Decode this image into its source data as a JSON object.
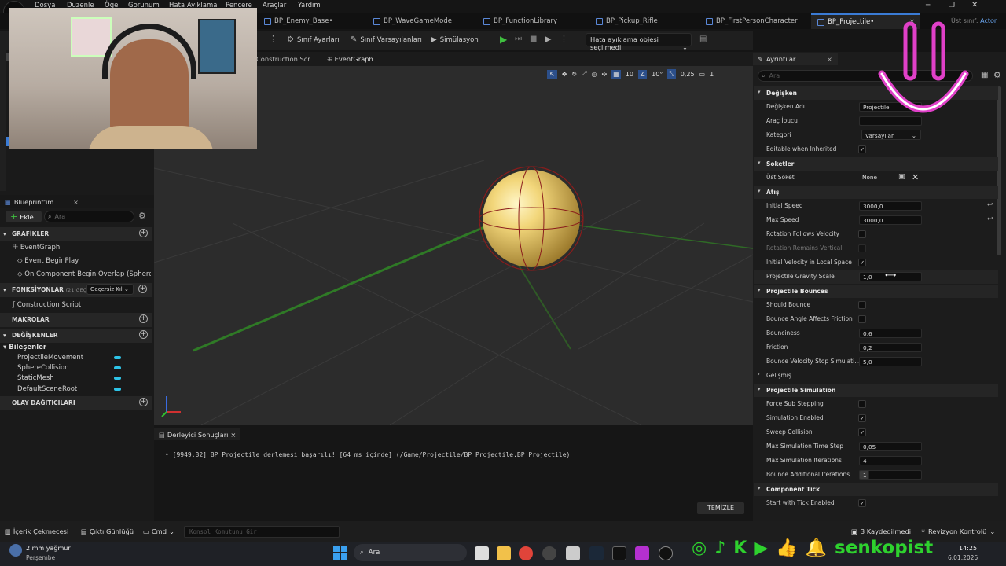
{
  "menu": [
    "Dosya",
    "Düzenle",
    "Öğe",
    "Görünüm",
    "Hata Ayıklama",
    "Pencere",
    "Araçlar",
    "Yardım"
  ],
  "tabs": [
    "BP_Enemy_Base•",
    "BP_WaveGameMode",
    "BP_FunctionLibrary",
    "BP_Pickup_Rifle",
    "BP_FirstPersonCharacter",
    "BP_Projectile•"
  ],
  "parent_class_label": "Üst sınıf:",
  "parent_class_value": "Actor",
  "toolbar": {
    "class_settings": "Sınıf Ayarları",
    "class_defaults": "Sınıf Varsayılanları",
    "simulation": "Simülasyon",
    "debug_object": "Hata ayıklama objesi seçilmedi"
  },
  "graph_tabs": [
    "Construction Scr...",
    "EventGraph"
  ],
  "viewport_controls": {
    "grid": "10",
    "rotation": "10°",
    "scale": "0,25",
    "camera": "1"
  },
  "my_blueprint": {
    "title": "Blueprint'im",
    "add": "Ekle",
    "search_placeholder": "Ara",
    "graphs_header": "GRAFİKLER",
    "event_graph": "EventGraph",
    "events": [
      "Event BeginPlay",
      "On Component Begin Overlap (SphereCol"
    ],
    "functions_header": "FONKSİYONLAR",
    "functions_count": "(21 GEÇERSİZ",
    "functions_filter": "Geçersiz Kıl",
    "construction_script": "Construction Script",
    "macros_header": "MAKROLAR",
    "variables_header": "DEĞİŞKENLER",
    "components_header": "Bileşenler",
    "components": [
      "ProjectileMovement",
      "SphereCollision",
      "StaticMesh",
      "DefaultSceneRoot"
    ],
    "dispatchers_header": "OLAY DAĞITICILARI"
  },
  "compiler": {
    "tab": "Derleyici Sonuçları",
    "message": "[9949.82] BP_Projectile derlemesi başarılı! [64 ms içinde] (/Game/Projectile/BP_Projectile.BP_Projectile)",
    "clear": "TEMİZLE"
  },
  "details": {
    "tab": "Ayrıntılar",
    "search_placeholder": "Ara",
    "variable_section": "Değişken",
    "var_name_label": "Değişken Adı",
    "var_name_value": "Projectile",
    "tooltip_label": "Araç İpucu",
    "category_label": "Kategori",
    "category_value": "Varsayılan",
    "editable_inherited": "Editable when Inherited",
    "sockets_section": "Soketler",
    "parent_socket_label": "Üst Soket",
    "parent_socket_value": "None",
    "firing_section": "Atış",
    "initial_speed_label": "Initial Speed",
    "initial_speed": "3000,0",
    "max_speed_label": "Max Speed",
    "max_speed": "3000,0",
    "rotation_follows_velocity": "Rotation Follows Velocity",
    "rotation_remains_vertical": "Rotation Remains Vertical",
    "initial_velocity_local": "Initial Velocity in Local Space",
    "gravity_scale_label": "Projectile Gravity Scale",
    "gravity_scale": "1,0",
    "bounces_section": "Projectile Bounces",
    "should_bounce": "Should Bounce",
    "bounce_angle_friction": "Bounce Angle Affects Friction",
    "bounciness_label": "Bounciness",
    "bounciness": "0,6",
    "friction_label": "Friction",
    "friction": "0,2",
    "bounce_velocity_stop_label": "Bounce Velocity Stop Simulati...",
    "bounce_velocity_stop": "5,0",
    "advanced": "Gelişmiş",
    "simulation_section": "Projectile Simulation",
    "force_sub_stepping": "Force Sub Stepping",
    "simulation_enabled": "Simulation Enabled",
    "sweep_collision": "Sweep Collision",
    "max_sim_time_step_label": "Max Simulation Time Step",
    "max_sim_time_step": "0,05",
    "max_sim_iterations_label": "Max Simulation Iterations",
    "max_sim_iterations": "4",
    "bounce_additional_iterations_label": "Bounce Additional Iterations",
    "bounce_additional_iterations": "1",
    "tick_section": "Component Tick",
    "start_with_tick": "Start with Tick Enabled"
  },
  "statusbar": {
    "content_drawer": "İçerik Çekmecesi",
    "output_log": "Çıktı Günlüğü",
    "cmd": "Cmd",
    "console_placeholder": "Konsol Komutunu Gir",
    "unsaved": "3 Kaydedilmedi",
    "revision": "Revizyon Kontrolü"
  },
  "taskbar": {
    "weather": "2 mm yağmur",
    "day": "Perşembe",
    "search": "Ara",
    "time": "14:25",
    "date": "6.01.2026"
  },
  "watermark": "senkopist",
  "colors": {
    "accent": "#3a7bd5",
    "logo_pink": "#e040c8",
    "social_green": "#2ed12e",
    "component_cyan": "#2ec4e8"
  }
}
